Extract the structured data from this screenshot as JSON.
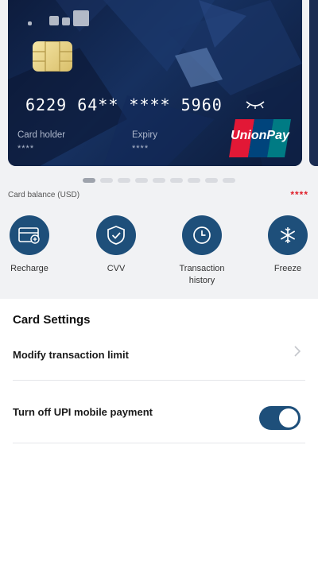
{
  "card": {
    "number": "6229 64** **** 5960",
    "holder_label": "Card holder",
    "holder_value": "****",
    "expiry_label": "Expiry",
    "expiry_value": "****",
    "network": "UnionPay"
  },
  "carousel": {
    "count": 9,
    "active_index": 0
  },
  "balance": {
    "label": "Card balance (USD)",
    "value": "****"
  },
  "actions": [
    {
      "label": "Recharge",
      "icon": "recharge-card-icon"
    },
    {
      "label": "CVV",
      "icon": "shield-check-icon"
    },
    {
      "label_line1": "Transaction",
      "label_line2": "history",
      "icon": "clock-icon"
    },
    {
      "label": "Freeze",
      "icon": "snowflake-icon"
    }
  ],
  "settings": {
    "title": "Card Settings",
    "limit_label": "Modify transaction limit",
    "upi_label": "Turn off UPI mobile payment",
    "upi_toggle_on": true
  },
  "colors": {
    "accent": "#1e4f7a",
    "card_bg": "#102449",
    "balance_mask": "#e0202a",
    "unionpay_red": "#e21836",
    "unionpay_blue": "#00447c",
    "unionpay_teal": "#007b84"
  }
}
